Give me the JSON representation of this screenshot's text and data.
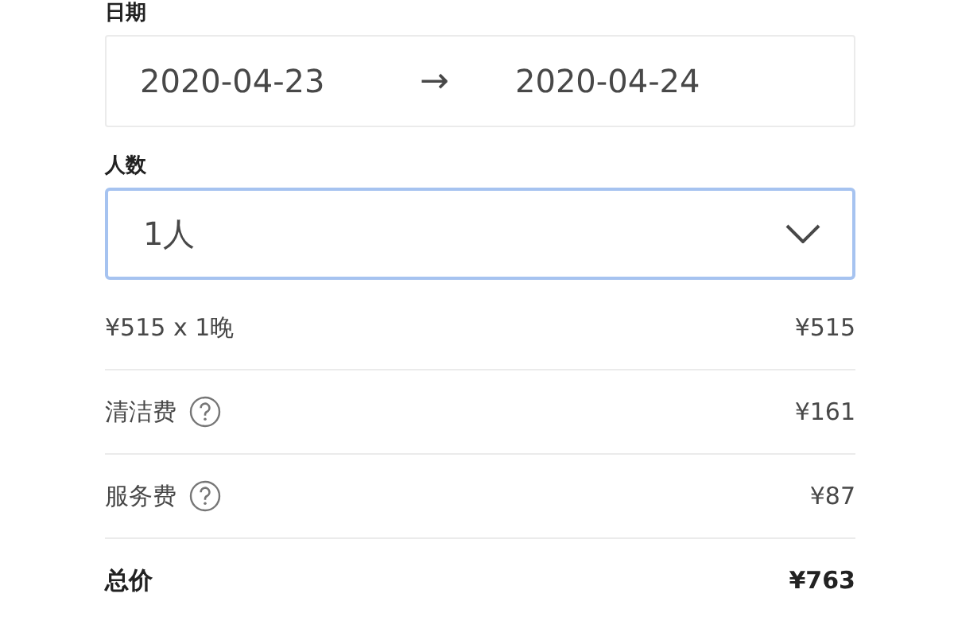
{
  "date": {
    "label": "日期",
    "start": "2020-04-23",
    "arrow": "→",
    "end": "2020-04-24"
  },
  "guests": {
    "label": "人数",
    "value": "1人",
    "focused": true
  },
  "price_rows": [
    {
      "kind": "plain",
      "label": "¥515 x 1晚",
      "amount": "¥515"
    },
    {
      "kind": "help",
      "label": "清洁费",
      "amount": "¥161"
    },
    {
      "kind": "help",
      "label": "服务费",
      "amount": "¥87"
    },
    {
      "kind": "total",
      "label": "总价",
      "amount": "¥763"
    }
  ]
}
